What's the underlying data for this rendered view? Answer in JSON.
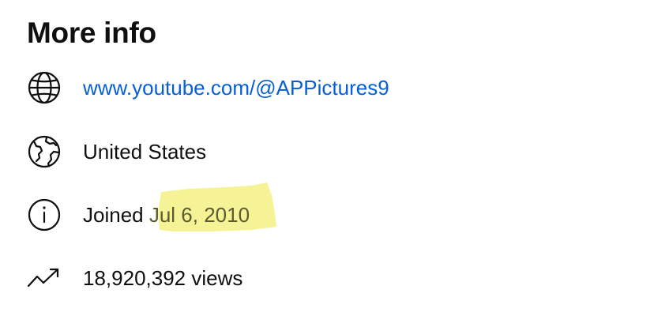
{
  "section": {
    "title": "More info"
  },
  "website": {
    "icon": "globe-icon",
    "url_text": "www.youtube.com/@APPictures9"
  },
  "location": {
    "icon": "earth-icon",
    "text": "United States"
  },
  "joined": {
    "icon": "info-icon",
    "prefix": "Joined ",
    "date": "Jul 6, 2010",
    "highlight_color": "#f4f28a"
  },
  "views": {
    "icon": "trending-icon",
    "text": "18,920,392 views"
  },
  "colors": {
    "link": "#065fd4",
    "text": "#0f0f0f"
  }
}
